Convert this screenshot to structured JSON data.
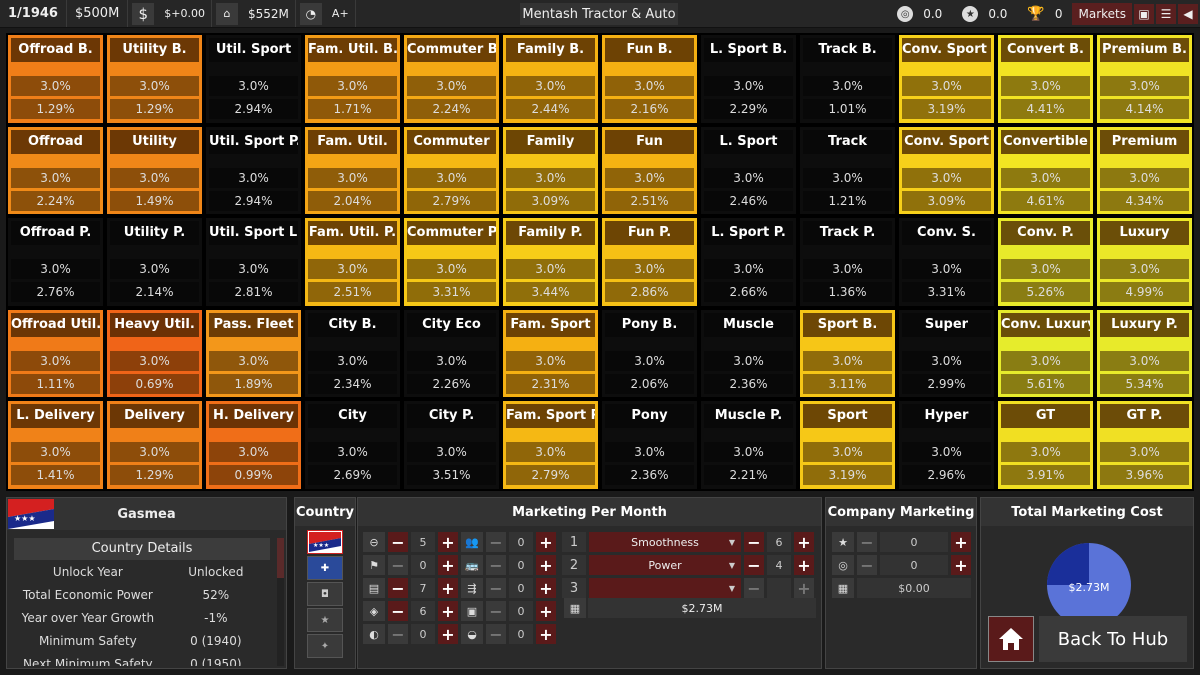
{
  "topbar": {
    "date": "1/1946",
    "funds": "$500M",
    "dollar_icon": "$",
    "delta": "$+0.00",
    "asset_value": "$552M",
    "rank_label": "A+",
    "company": "Mentash Tractor & Auto",
    "stat1": "0.0",
    "stat2": "0.0",
    "trophies": "0",
    "markets": "Markets"
  },
  "grid": [
    [
      {
        "name": "Offroad B.",
        "a": "3.0%",
        "b": "1.29%",
        "c": "#f07e18"
      },
      {
        "name": "Utility B.",
        "a": "3.0%",
        "b": "1.29%",
        "c": "#f08518"
      },
      {
        "name": "Util. Sport",
        "a": "3.0%",
        "b": "2.94%",
        "c": "#0d0d0d",
        "k": true
      },
      {
        "name": "Fam. Util. B.",
        "a": "3.0%",
        "b": "1.71%",
        "c": "#f39b15"
      },
      {
        "name": "Commuter B.",
        "a": "3.0%",
        "b": "2.24%",
        "c": "#f4a914"
      },
      {
        "name": "Family B.",
        "a": "3.0%",
        "b": "2.44%",
        "c": "#f5b312"
      },
      {
        "name": "Fun B.",
        "a": "3.0%",
        "b": "2.16%",
        "c": "#f5b012"
      },
      {
        "name": "L. Sport B.",
        "a": "3.0%",
        "b": "2.29%",
        "c": "#0d0d0d",
        "k": true
      },
      {
        "name": "Track B.",
        "a": "3.0%",
        "b": "1.01%",
        "c": "#0d0d0d",
        "k": true
      },
      {
        "name": "Conv. Sport B.",
        "a": "3.0%",
        "b": "3.19%",
        "c": "#f7d11a"
      },
      {
        "name": "Convert B.",
        "a": "3.0%",
        "b": "4.41%",
        "c": "#f2e422"
      },
      {
        "name": "Premium B.",
        "a": "3.0%",
        "b": "4.14%",
        "c": "#f0e324"
      }
    ],
    [
      {
        "name": "Offroad",
        "a": "3.0%",
        "b": "2.24%",
        "c": "#f08a18"
      },
      {
        "name": "Utility",
        "a": "3.0%",
        "b": "1.49%",
        "c": "#f08618"
      },
      {
        "name": "Util. Sport P.",
        "a": "3.0%",
        "b": "2.94%",
        "c": "#0d0d0d",
        "k": true
      },
      {
        "name": "Fam. Util.",
        "a": "3.0%",
        "b": "2.04%",
        "c": "#f4a515"
      },
      {
        "name": "Commuter",
        "a": "3.0%",
        "b": "2.79%",
        "c": "#f5b813"
      },
      {
        "name": "Family",
        "a": "3.0%",
        "b": "3.09%",
        "c": "#f6c516"
      },
      {
        "name": "Fun",
        "a": "3.0%",
        "b": "2.51%",
        "c": "#f5b312"
      },
      {
        "name": "L. Sport",
        "a": "3.0%",
        "b": "2.46%",
        "c": "#0d0d0d",
        "k": true
      },
      {
        "name": "Track",
        "a": "3.0%",
        "b": "1.21%",
        "c": "#0d0d0d",
        "k": true
      },
      {
        "name": "Conv. Sport",
        "a": "3.0%",
        "b": "3.09%",
        "c": "#f7d01a"
      },
      {
        "name": "Convertible",
        "a": "3.0%",
        "b": "4.61%",
        "c": "#f2e522"
      },
      {
        "name": "Premium",
        "a": "3.0%",
        "b": "4.34%",
        "c": "#f0e324"
      }
    ],
    [
      {
        "name": "Offroad P.",
        "a": "3.0%",
        "b": "2.76%",
        "c": "#0d0d0d",
        "k": true
      },
      {
        "name": "Utility P.",
        "a": "3.0%",
        "b": "2.14%",
        "c": "#0d0d0d",
        "k": true
      },
      {
        "name": "Util. Sport L.",
        "a": "3.0%",
        "b": "2.81%",
        "c": "#0d0d0d",
        "k": true
      },
      {
        "name": "Fam. Util. P.",
        "a": "3.0%",
        "b": "2.51%",
        "c": "#f5b814"
      },
      {
        "name": "Commuter P.",
        "a": "3.0%",
        "b": "3.31%",
        "c": "#f6c816"
      },
      {
        "name": "Family P.",
        "a": "3.0%",
        "b": "3.44%",
        "c": "#f7cd18"
      },
      {
        "name": "Fun P.",
        "a": "3.0%",
        "b": "2.86%",
        "c": "#f6c015"
      },
      {
        "name": "L. Sport P.",
        "a": "3.0%",
        "b": "2.66%",
        "c": "#0d0d0d",
        "k": true
      },
      {
        "name": "Track P.",
        "a": "3.0%",
        "b": "1.36%",
        "c": "#0d0d0d",
        "k": true
      },
      {
        "name": "Conv. S.",
        "a": "3.0%",
        "b": "3.31%",
        "c": "#0d0d0d",
        "k": true
      },
      {
        "name": "Conv. P.",
        "a": "3.0%",
        "b": "5.26%",
        "c": "#e8ea2a"
      },
      {
        "name": "Luxury",
        "a": "3.0%",
        "b": "4.99%",
        "c": "#ebe828"
      }
    ],
    [
      {
        "name": "Offroad Util.",
        "a": "3.0%",
        "b": "1.11%",
        "c": "#f07a18"
      },
      {
        "name": "Heavy Util.",
        "a": "3.0%",
        "b": "0.69%",
        "c": "#f06418"
      },
      {
        "name": "Pass. Fleet",
        "a": "3.0%",
        "b": "1.89%",
        "c": "#f3971a"
      },
      {
        "name": "City B.",
        "a": "3.0%",
        "b": "2.34%",
        "c": "#0d0d0d",
        "k": true
      },
      {
        "name": "City Eco",
        "a": "3.0%",
        "b": "2.26%",
        "c": "#0d0d0d",
        "k": true
      },
      {
        "name": "Fam. Sport",
        "a": "3.0%",
        "b": "2.31%",
        "c": "#f5b012"
      },
      {
        "name": "Pony B.",
        "a": "3.0%",
        "b": "2.06%",
        "c": "#0d0d0d",
        "k": true
      },
      {
        "name": "Muscle",
        "a": "3.0%",
        "b": "2.36%",
        "c": "#0d0d0d",
        "k": true
      },
      {
        "name": "Sport B.",
        "a": "3.0%",
        "b": "3.11%",
        "c": "#f6c617"
      },
      {
        "name": "Super",
        "a": "3.0%",
        "b": "2.99%",
        "c": "#0d0d0d",
        "k": true
      },
      {
        "name": "Conv. Luxury",
        "a": "3.0%",
        "b": "5.61%",
        "c": "#e6ec2c"
      },
      {
        "name": "Luxury P.",
        "a": "3.0%",
        "b": "5.34%",
        "c": "#e8ea2a"
      }
    ],
    [
      {
        "name": "L. Delivery",
        "a": "3.0%",
        "b": "1.41%",
        "c": "#f08218"
      },
      {
        "name": "Delivery",
        "a": "3.0%",
        "b": "1.29%",
        "c": "#f08018"
      },
      {
        "name": "H. Delivery",
        "a": "3.0%",
        "b": "0.99%",
        "c": "#f06e18"
      },
      {
        "name": "City",
        "a": "3.0%",
        "b": "2.69%",
        "c": "#0d0d0d",
        "k": true
      },
      {
        "name": "City P.",
        "a": "3.0%",
        "b": "3.51%",
        "c": "#0d0d0d",
        "k": true
      },
      {
        "name": "Fam. Sport P.",
        "a": "3.0%",
        "b": "2.79%",
        "c": "#f5b814"
      },
      {
        "name": "Pony",
        "a": "3.0%",
        "b": "2.36%",
        "c": "#0d0d0d",
        "k": true
      },
      {
        "name": "Muscle P.",
        "a": "3.0%",
        "b": "2.21%",
        "c": "#0d0d0d",
        "k": true
      },
      {
        "name": "Sport",
        "a": "3.0%",
        "b": "3.19%",
        "c": "#f6c817"
      },
      {
        "name": "Hyper",
        "a": "3.0%",
        "b": "2.96%",
        "c": "#0d0d0d",
        "k": true
      },
      {
        "name": "GT",
        "a": "3.0%",
        "b": "3.91%",
        "c": "#f1df22"
      },
      {
        "name": "GT P.",
        "a": "3.0%",
        "b": "3.96%",
        "c": "#f0e024"
      }
    ]
  ],
  "country_panel": {
    "name": "Gasmea",
    "details_header": "Country Details",
    "rows": [
      {
        "label": "Unlock Year",
        "value": "Unlocked"
      },
      {
        "label": "Total Economic Power",
        "value": "52%"
      },
      {
        "label": "Year over Year Growth",
        "value": "-1%"
      },
      {
        "label": "Minimum Safety",
        "value": "0 (1940)"
      },
      {
        "label": "Next Minimum Safety",
        "value": "0 (1950)"
      }
    ]
  },
  "country_list": {
    "header": "Country"
  },
  "marketing": {
    "header": "Marketing Per Month",
    "ad_rows": [
      {
        "icon": "⊖",
        "n1": "5",
        "icon2": "👥",
        "n2": "0"
      },
      {
        "icon": "⚑",
        "n1": "0",
        "icon2": "🚌",
        "n2": "0"
      },
      {
        "icon": "▤",
        "n1": "7",
        "icon2": "⇶",
        "n2": "0"
      },
      {
        "icon": "◈",
        "n1": "6",
        "icon2": "▣",
        "n2": "0"
      },
      {
        "icon": "◐",
        "n1": "0",
        "icon2": "◒",
        "n2": "0"
      }
    ],
    "focus_rows": [
      {
        "rank": "1",
        "option": "Smoothness",
        "value": "6"
      },
      {
        "rank": "2",
        "option": "Power",
        "value": "4"
      },
      {
        "rank": "3",
        "option": "",
        "value": ""
      }
    ],
    "total": "$2.73M"
  },
  "company_marketing": {
    "header": "Company Marketing",
    "rows": [
      {
        "value": "0"
      },
      {
        "value": "0"
      }
    ],
    "total": "$0.00"
  },
  "total_cost": {
    "header": "Total Marketing Cost",
    "amount": "$2.73M",
    "pie_fraction": 0.75,
    "colors": {
      "main": "#5a73d8",
      "minor": "#1a2f9a"
    }
  },
  "buttons": {
    "home_icon": "home-icon",
    "back": "Back To Hub"
  }
}
